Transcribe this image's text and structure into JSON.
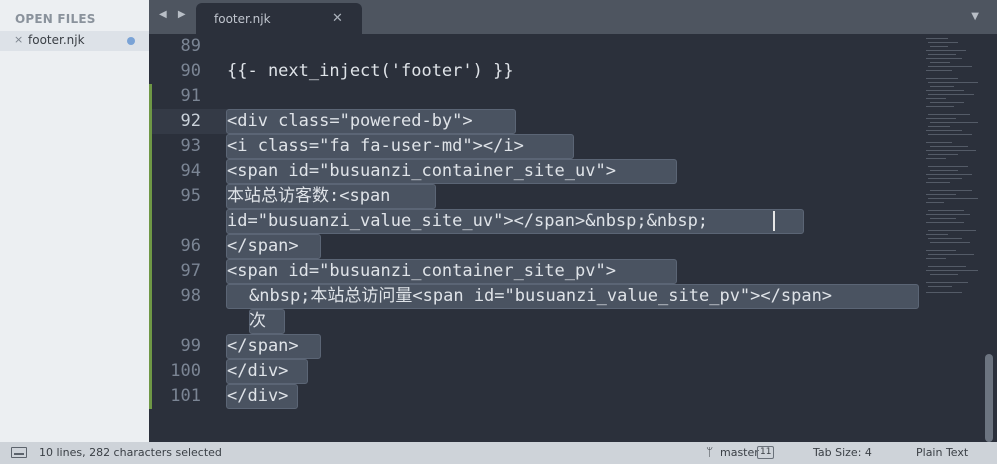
{
  "sidebar": {
    "title": "OPEN FILES",
    "files": [
      {
        "close": "×",
        "name": "footer.njk"
      }
    ]
  },
  "tabs": [
    {
      "label": "footer.njk",
      "close": "✕"
    }
  ],
  "nav": {
    "arrows": "◀ ▶",
    "dropdown": "▼"
  },
  "editor": {
    "line_numbers": [
      "89",
      "90",
      "91",
      "92",
      "93",
      "94",
      "95",
      "",
      "96",
      "97",
      "98",
      "",
      "99",
      "100",
      "101"
    ],
    "lines": [
      "",
      "{{- next_inject('footer') }}",
      "",
      "<div class=\"powered-by\">",
      "<i class=\"fa fa-user-md\"></i>",
      "<span id=\"busuanzi_container_site_uv\">",
      "本站总访客数:<span",
      "id=\"busuanzi_value_site_uv\"></span>&nbsp;&nbsp;",
      "</span>",
      "<span id=\"busuanzi_container_site_pv\">",
      "&nbsp;本站总访问量<span id=\"busuanzi_value_site_pv\"></span>",
      "次",
      "</span>",
      "</div>",
      "</div>"
    ]
  },
  "status": {
    "selection": "10 lines, 282 characters selected",
    "branch": "master",
    "branch_count": "11",
    "tab_size": "Tab Size: 4",
    "syntax": "Plain Text"
  },
  "colors": {
    "editor_bg": "#2b303b",
    "selection": "#4a5361",
    "gutter_modified": "#8bc34a",
    "sidebar_bg": "#eceff2",
    "statusbar_bg": "#ced3d9"
  }
}
